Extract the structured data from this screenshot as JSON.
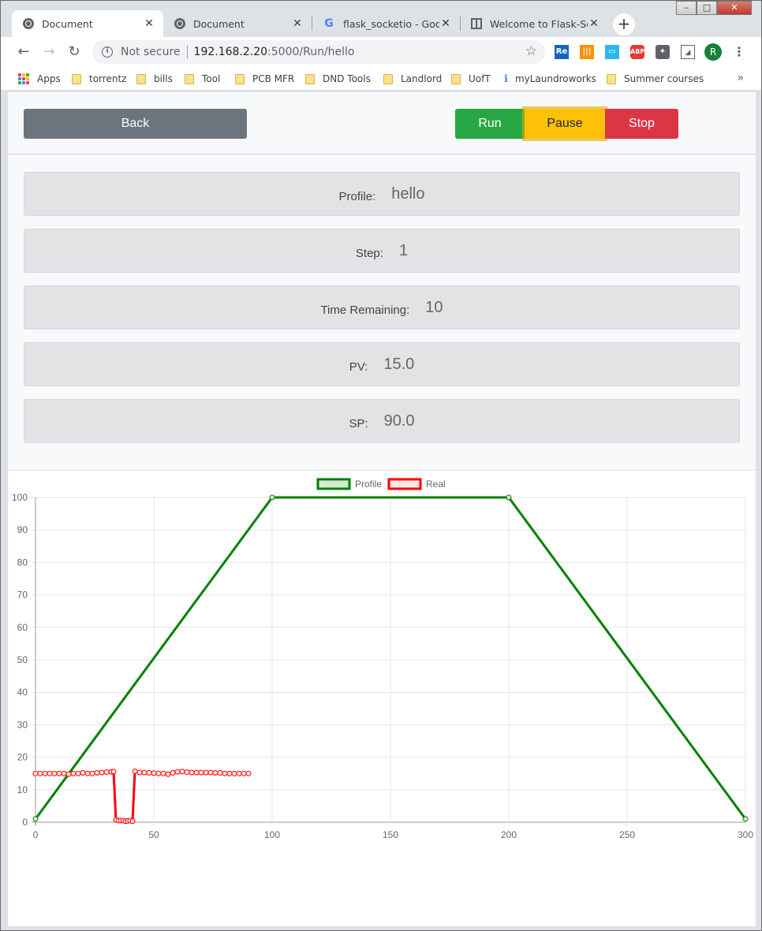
{
  "browser": {
    "tabs": [
      {
        "title": "Document",
        "icon": "globe-icon",
        "active": true
      },
      {
        "title": "Document",
        "icon": "globe-icon",
        "active": false
      },
      {
        "title": "flask_socketio - Google",
        "icon": "google-icon",
        "active": false
      },
      {
        "title": "Welcome to Flask-Sock",
        "icon": "book-icon",
        "active": false
      }
    ],
    "security_label": "Not secure",
    "url_host": "192.168.2.20",
    "url_path": ":5000/Run/hello",
    "profile_initial": "R",
    "bookmarks": [
      "Apps",
      "torrentz",
      "bills",
      "Tool",
      "PCB MFR",
      "DND Tools",
      "Landlord",
      "UofT",
      "myLaundroworks",
      "Summer courses"
    ],
    "bookmarks_more": "»"
  },
  "controls": {
    "back_label": "Back",
    "run_label": "Run",
    "pause_label": "Pause",
    "stop_label": "Stop",
    "colors": {
      "back": "#6c757d",
      "run": "#28a745",
      "pause": "#ffc107",
      "stop": "#dc3545"
    }
  },
  "status": {
    "profile_label": "Profile:",
    "profile_value": "hello",
    "step_label": "Step:",
    "step_value": "1",
    "time_label": "Time Remaining:",
    "time_value": "10",
    "pv_label": "PV:",
    "pv_value": "15.0",
    "sp_label": "SP:",
    "sp_value": "90.0"
  },
  "chart_data": {
    "type": "line",
    "xlim": [
      0,
      300
    ],
    "ylim": [
      0,
      100
    ],
    "xticks": [
      0,
      50,
      100,
      150,
      200,
      250,
      300
    ],
    "yticks": [
      0,
      10,
      20,
      30,
      40,
      50,
      60,
      70,
      80,
      90,
      100
    ],
    "grid": true,
    "legend_position": "top",
    "series": [
      {
        "name": "Profile",
        "color": "#008000",
        "fill": "#d9ead3",
        "x": [
          0,
          100,
          200,
          300
        ],
        "y": [
          1,
          100,
          100,
          1
        ]
      },
      {
        "name": "Real",
        "color": "#ff0000",
        "fill": "#fde6e6",
        "x": [
          0,
          2,
          4,
          6,
          8,
          10,
          12,
          14,
          16,
          18,
          20,
          22,
          24,
          26,
          28,
          30,
          32,
          33,
          34,
          35,
          36,
          37,
          38,
          39,
          40,
          41,
          42,
          44,
          46,
          48,
          50,
          52,
          54,
          56,
          58,
          60,
          62,
          64,
          66,
          68,
          70,
          72,
          74,
          76,
          78,
          80,
          82,
          84,
          86,
          88,
          90
        ],
        "y": [
          15,
          15,
          15,
          15,
          15,
          15,
          15,
          14.8,
          15,
          15,
          15.2,
          15,
          15,
          15.2,
          15.3,
          15.4,
          15.5,
          15.6,
          0.7,
          0.5,
          0.5,
          0.5,
          0.3,
          0.4,
          0.5,
          0.3,
          15.7,
          15.3,
          15.3,
          15.2,
          15.1,
          15,
          15,
          14.8,
          15.2,
          15.5,
          15.6,
          15.4,
          15.3,
          15.3,
          15.3,
          15.3,
          15.3,
          15.2,
          15.2,
          15,
          15,
          15,
          15,
          15,
          15
        ]
      }
    ]
  }
}
